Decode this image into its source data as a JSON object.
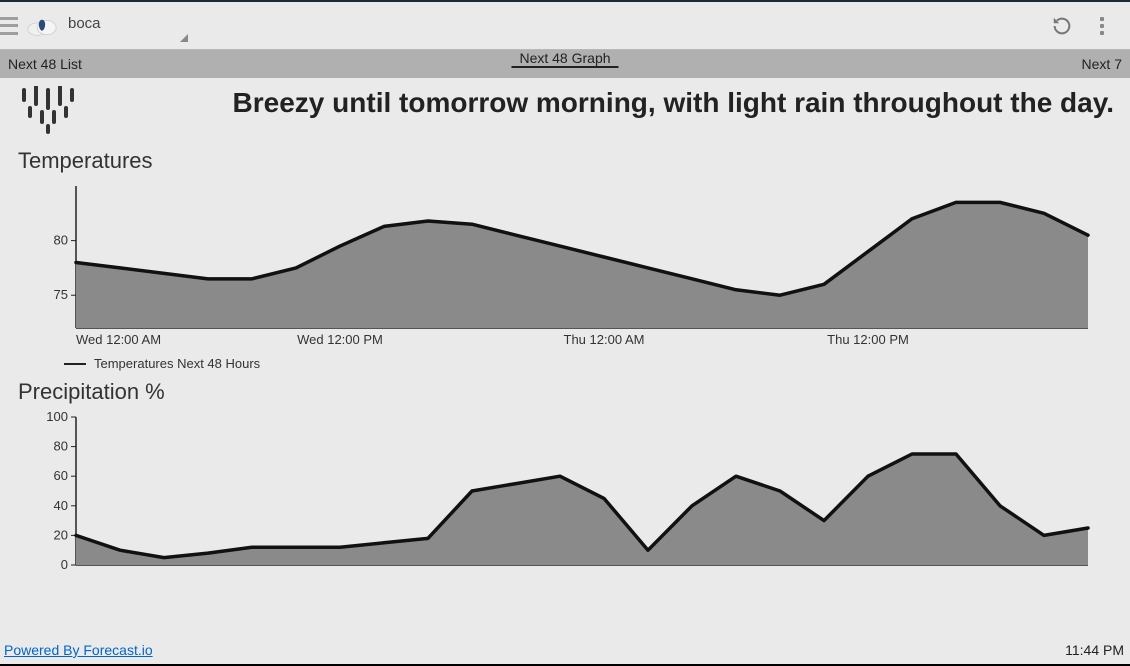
{
  "toolbar": {
    "location": "boca"
  },
  "tabs": {
    "left": "Next 48 List",
    "center": "Next 48 Graph",
    "right": "Next 7"
  },
  "summary": "Breezy until tomorrow morning, with light rain throughout the day.",
  "sections": {
    "temperatures": "Temperatures",
    "precipitation": "Precipitation %"
  },
  "legend": {
    "temp": "Temperatures Next 48 Hours"
  },
  "footer": {
    "powered": "Powered By Forecast.io",
    "time": "11:44 PM"
  },
  "chart_data": [
    {
      "type": "area",
      "title": "Temperatures",
      "xlabel": "",
      "ylabel": "",
      "ylim": [
        72,
        85
      ],
      "y_ticks": [
        75,
        80
      ],
      "categories": [
        "Wed 12:00 AM",
        "",
        "",
        "",
        "",
        "",
        "Wed 12:00 PM",
        "",
        "",
        "",
        "",
        "",
        "Thu 12:00 AM",
        "",
        "",
        "",
        "",
        "",
        "Thu 12:00 PM",
        "",
        "",
        "",
        "",
        ""
      ],
      "x_tick_labels": [
        "Wed 12:00 AM",
        "Wed 12:00 PM",
        "Thu 12:00 AM",
        "Thu 12:00 PM"
      ],
      "series": [
        {
          "name": "Temperatures Next 48 Hours",
          "values": [
            78.0,
            77.5,
            77.0,
            76.5,
            76.5,
            77.5,
            79.5,
            81.3,
            81.8,
            81.5,
            80.5,
            79.5,
            78.5,
            77.5,
            76.5,
            75.5,
            75.0,
            76.0,
            79.0,
            82.0,
            83.5,
            83.5,
            82.5,
            80.5
          ]
        }
      ]
    },
    {
      "type": "area",
      "title": "Precipitation %",
      "xlabel": "",
      "ylabel": "",
      "ylim": [
        0,
        100
      ],
      "y_ticks": [
        0,
        20,
        40,
        60,
        80,
        100
      ],
      "categories": [
        "Wed 12:00 AM",
        "",
        "",
        "",
        "",
        "",
        "Wed 12:00 PM",
        "",
        "",
        "",
        "",
        "",
        "Thu 12:00 AM",
        "",
        "",
        "",
        "",
        "",
        "Thu 12:00 PM",
        "",
        "",
        "",
        "",
        ""
      ],
      "series": [
        {
          "name": "Precipitation %",
          "values": [
            20,
            10,
            5,
            8,
            12,
            12,
            12,
            15,
            18,
            50,
            55,
            60,
            45,
            10,
            40,
            60,
            50,
            30,
            60,
            75,
            75,
            40,
            20,
            25
          ]
        }
      ]
    }
  ]
}
